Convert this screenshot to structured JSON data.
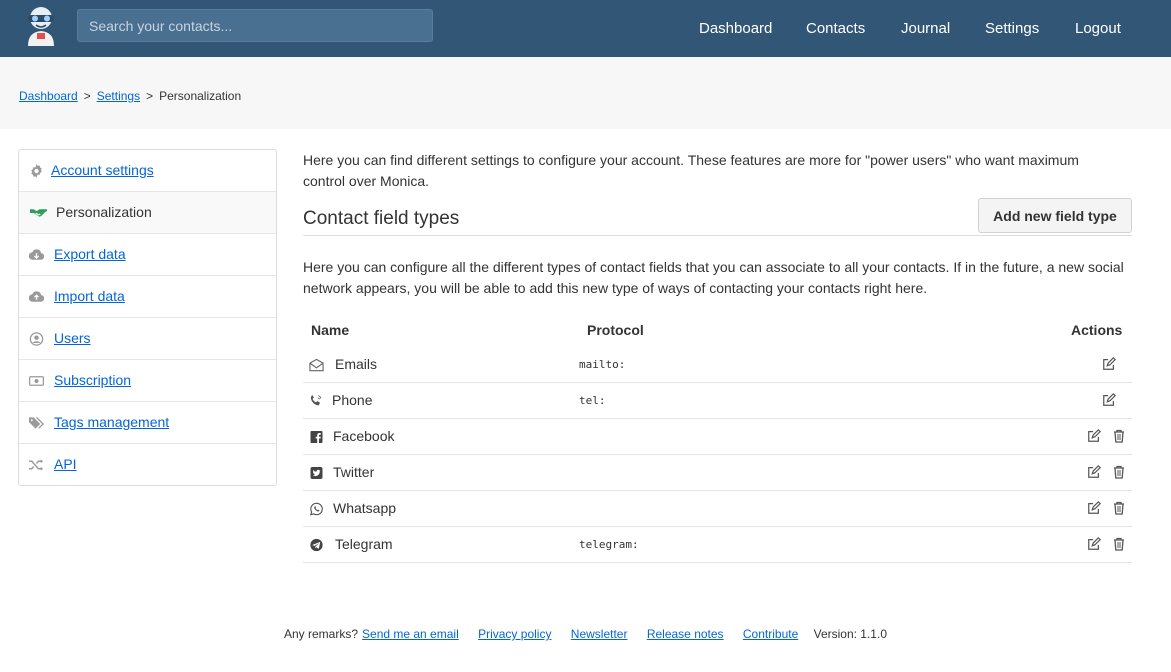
{
  "header": {
    "search_placeholder": "Search your contacts...",
    "nav": [
      {
        "label": "Dashboard"
      },
      {
        "label": "Contacts"
      },
      {
        "label": "Journal"
      },
      {
        "label": "Settings"
      },
      {
        "label": "Logout"
      }
    ]
  },
  "breadcrumb": {
    "items": [
      "Dashboard",
      "Settings"
    ],
    "separator": ">",
    "current": "Personalization"
  },
  "sidebar": {
    "items": [
      {
        "label": "Account settings",
        "icon": "gear-icon"
      },
      {
        "label": "Personalization",
        "icon": "handshake-icon",
        "active": true
      },
      {
        "label": "Export data",
        "icon": "cloud-download-icon"
      },
      {
        "label": "Import data",
        "icon": "cloud-upload-icon"
      },
      {
        "label": "Users",
        "icon": "user-circle-icon"
      },
      {
        "label": "Subscription",
        "icon": "money-icon"
      },
      {
        "label": "Tags management",
        "icon": "tags-icon"
      },
      {
        "label": "API",
        "icon": "shuffle-icon"
      }
    ]
  },
  "main": {
    "intro": "Here you can find different settings to configure your account. These features are more for \"power users\" who want maximum control over Monica.",
    "section_title": "Contact field types",
    "add_button_label": "Add new field type",
    "description": "Here you can configure all the different types of contact fields that you can associate to all your contacts. If in the future, a new social network appears, you will be able to add this new type of ways of contacting your contacts right here.",
    "table": {
      "headers": {
        "name": "Name",
        "protocol": "Protocol",
        "actions": "Actions"
      },
      "rows": [
        {
          "name": "Emails",
          "protocol": "mailto:",
          "icon": "envelope-icon",
          "deletable": false
        },
        {
          "name": "Phone",
          "protocol": "tel:",
          "icon": "phone-icon",
          "deletable": false
        },
        {
          "name": "Facebook",
          "protocol": "",
          "icon": "facebook-icon",
          "deletable": true
        },
        {
          "name": "Twitter",
          "protocol": "",
          "icon": "twitter-icon",
          "deletable": true
        },
        {
          "name": "Whatsapp",
          "protocol": "",
          "icon": "whatsapp-icon",
          "deletable": true
        },
        {
          "name": "Telegram",
          "protocol": "telegram:",
          "icon": "telegram-icon",
          "deletable": true
        }
      ]
    }
  },
  "footer": {
    "remarks_label": "Any remarks?",
    "links": [
      "Send me an email",
      "Privacy policy",
      "Newsletter",
      "Release notes",
      "Contribute"
    ],
    "version": "Version: 1.1.0"
  },
  "colors": {
    "header_bg": "#325776",
    "link": "#0366d6",
    "accent_green": "#2e9e5b"
  }
}
